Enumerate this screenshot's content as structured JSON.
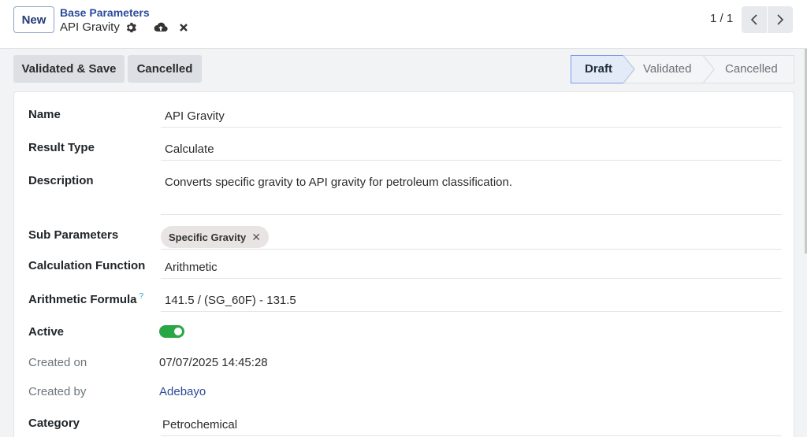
{
  "control_panel": {
    "new_label": "New",
    "breadcrumb_parent": "Base Parameters",
    "breadcrumb_current": "API Gravity",
    "pager": "1 / 1"
  },
  "statusbar": {
    "buttons": [
      "Validated & Save",
      "Cancelled"
    ],
    "stages": [
      "Draft",
      "Validated",
      "Cancelled"
    ],
    "active_stage": "Draft"
  },
  "form": {
    "name": {
      "label": "Name",
      "value": "API Gravity"
    },
    "result_type": {
      "label": "Result Type",
      "value": "Calculate"
    },
    "description": {
      "label": "Description",
      "value": "Converts specific gravity to API gravity for petroleum classification."
    },
    "sub_parameters": {
      "label": "Sub Parameters",
      "tags": [
        "Specific Gravity"
      ]
    },
    "calc_function": {
      "label": "Calculation Function",
      "value": "Arithmetic"
    },
    "formula": {
      "label": "Arithmetic Formula",
      "help": "?",
      "value": "141.5 / (SG_60F) - 131.5"
    },
    "active": {
      "label": "Active",
      "value": true
    },
    "created_on": {
      "label": "Created on",
      "value": "07/07/2025 14:45:28"
    },
    "created_by": {
      "label": "Created by",
      "value": "Adebayo"
    },
    "category": {
      "label": "Category",
      "value": "Petrochemical"
    }
  },
  "colors": {
    "accent": "#2b4a9b",
    "toggle_on": "#28a745",
    "stage_active_border": "#7b9ce6"
  },
  "icons": [
    "gear-icon",
    "cloud-upload-icon",
    "close-icon",
    "chevron-left-icon",
    "chevron-right-icon",
    "tag-remove-icon"
  ]
}
